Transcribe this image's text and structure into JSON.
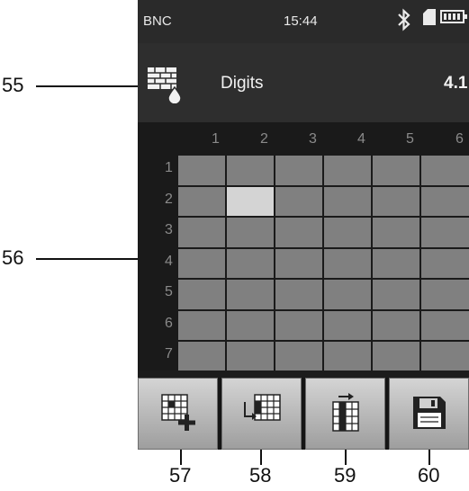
{
  "status_bar": {
    "carrier": "BNC",
    "time": "15:44"
  },
  "header": {
    "title": "Digits",
    "value": "4.1"
  },
  "grid": {
    "column_headers": [
      "1",
      "2",
      "3",
      "4",
      "5",
      "6"
    ],
    "row_headers": [
      "1",
      "2",
      "3",
      "4",
      "5",
      "6",
      "7"
    ],
    "selected_cell": {
      "row": 2,
      "column": 2
    }
  },
  "callouts": [
    "55",
    "56",
    "57",
    "58",
    "59",
    "60"
  ],
  "icons": {
    "status": [
      "bluetooth-icon",
      "sd-card-icon",
      "battery-icon"
    ],
    "header": "brick-wall-drop-icon",
    "toolbar": [
      "add-cell-icon",
      "move-cells-icon",
      "insert-column-icon",
      "save-icon"
    ]
  }
}
